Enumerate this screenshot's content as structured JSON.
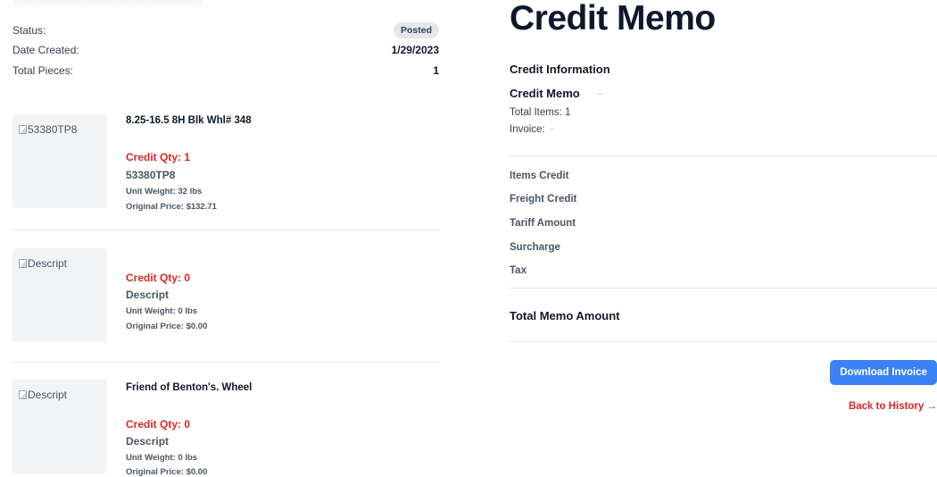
{
  "summary": {
    "status_label": "Status:",
    "status_value": "Posted",
    "date_label": "Date Created:",
    "date_value": "1/29/2023",
    "pieces_label": "Total Pieces:",
    "pieces_value": "1"
  },
  "items": [
    {
      "image_alt": "53380TP8",
      "title": "8.25-16.5 8H Blk Whl# 348",
      "credit_qty": "Credit Qty: 1",
      "sku": "53380TP8",
      "unit_weight": "Unit Weight: 32 lbs",
      "original_price": "Original Price: $132.71"
    },
    {
      "image_alt": "Descript",
      "title": "",
      "credit_qty": "Credit Qty: 0",
      "sku": "Descript",
      "unit_weight": "Unit Weight: 0 lbs",
      "original_price": "Original Price: $0.00"
    },
    {
      "image_alt": "Descript",
      "title": "Friend of Benton's. Wheel",
      "credit_qty": "Credit Qty: 0",
      "sku": "Descript",
      "unit_weight": "Unit Weight: 0 lbs",
      "original_price": "Original Price: $0.00"
    }
  ],
  "memo": {
    "page_title": "Credit Memo",
    "section_title": "Credit Information",
    "memo_name": "Credit Memo",
    "total_items": "Total Items: 1",
    "invoice_label": "Invoice:",
    "items_credit": "Items Credit",
    "freight_credit": "Freight Credit",
    "tariff_amount": "Tariff Amount",
    "surcharge": "Surcharge",
    "tax": "Tax",
    "total_memo_amount": "Total Memo Amount",
    "download_button": "Download Invoice",
    "back_link": "Back to History →"
  },
  "colors": {
    "accent": "#3b82f6",
    "danger": "#dc2626",
    "badge_bg": "#e5e7eb"
  }
}
